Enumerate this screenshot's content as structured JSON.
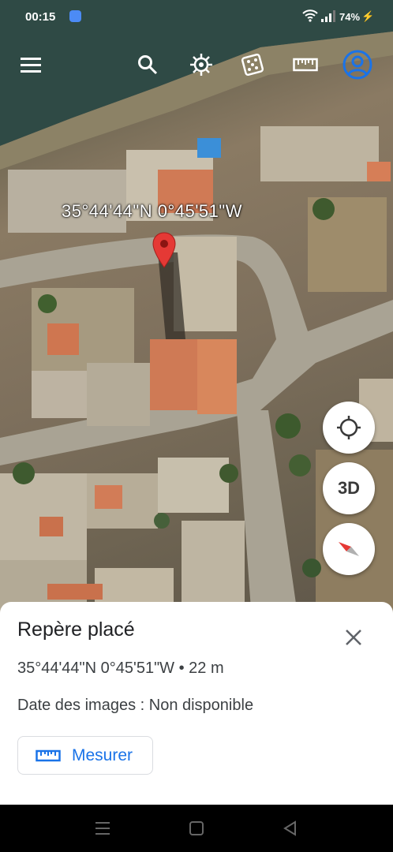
{
  "status_bar": {
    "time": "00:15",
    "battery": "74%"
  },
  "toolbar": {
    "icons": [
      "menu-icon",
      "search-icon",
      "voyager-icon",
      "random-icon",
      "measure-icon",
      "account-icon"
    ]
  },
  "map": {
    "coordinates_overlay": "35°44'44\"N 0°45'51\"W"
  },
  "map_controls": {
    "three_d_label": "3D"
  },
  "sheet": {
    "title": "Repère placé",
    "coordinates": "35°44'44\"N 0°45'51\"W • 22 m",
    "image_date": "Date des images : Non disponible",
    "measure_label": "Mesurer"
  },
  "colors": {
    "accent": "#1a73e8",
    "pin": "#e53935"
  }
}
